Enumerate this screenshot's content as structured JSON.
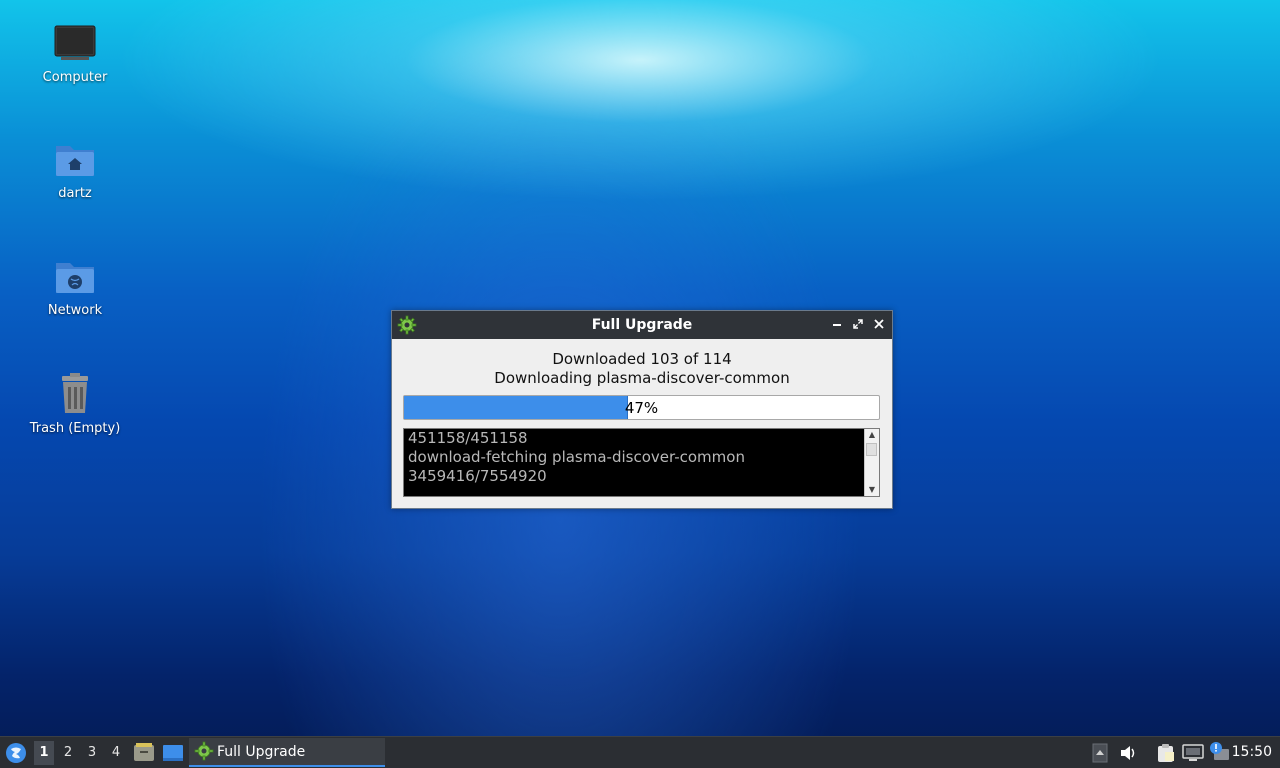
{
  "desktop": {
    "icons": [
      {
        "label": "Computer",
        "icon": "monitor-icon"
      },
      {
        "label": "dartz",
        "icon": "home-folder-icon"
      },
      {
        "label": "Network",
        "icon": "network-folder-icon"
      },
      {
        "label": "Trash (Empty)",
        "icon": "trash-icon"
      }
    ]
  },
  "dialog": {
    "title": "Full Upgrade",
    "app_icon": "gear-icon",
    "status_line_1": "Downloaded 103 of 114",
    "status_line_2": "Downloading plasma-discover-common",
    "progress": {
      "percent_label": "47%",
      "percent": 47
    },
    "log_lines": [
      "451158/451158",
      "download-fetching plasma-discover-common",
      "3459416/7554920"
    ],
    "controls": {
      "minimize": "minimize-icon",
      "maximize": "maximize-icon",
      "close": "close-icon"
    }
  },
  "taskbar": {
    "start_icon": "lxqt-menu-icon",
    "workspaces": [
      "1",
      "2",
      "3",
      "4"
    ],
    "active_workspace": "1",
    "quicklaunch": [
      "file-manager-icon",
      "show-desktop-icon"
    ],
    "task": {
      "label": "Full Upgrade",
      "icon": "gear-icon"
    },
    "tray": [
      "tray-up-arrow-icon",
      "volume-icon",
      "clipboard-icon",
      "network-icon",
      "notification-icon"
    ],
    "clock": "15:50"
  },
  "colors": {
    "accent": "#3d8eea",
    "panel": "#2b2e33",
    "titlebar": "#2f3338"
  }
}
